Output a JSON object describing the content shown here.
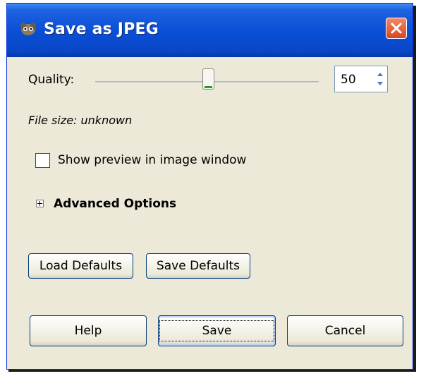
{
  "window": {
    "title": "Save as JPEG",
    "icon": "gimp-wilber-icon",
    "close_icon": "close-icon"
  },
  "quality": {
    "label": "Quality:",
    "value": "50",
    "slider_fraction": 0.5
  },
  "file_size": "File size: unknown",
  "preview_checkbox": {
    "label": "Show preview in image window",
    "checked": false
  },
  "advanced": {
    "label": "Advanced Options",
    "expanded": false
  },
  "defaults_buttons": {
    "load": "Load Defaults",
    "save": "Save Defaults"
  },
  "actions": {
    "help": "Help",
    "save": "Save",
    "cancel": "Cancel"
  },
  "colors": {
    "titlebar": "#0a4fd6",
    "dialog_bg": "#ece9d8",
    "close_button": "#d6471e"
  }
}
